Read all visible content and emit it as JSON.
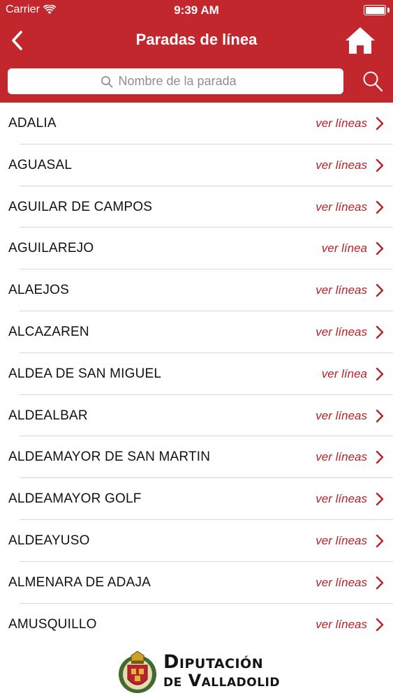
{
  "status_bar": {
    "carrier": "Carrier",
    "time": "9:39 AM"
  },
  "header": {
    "title": "Paradas de línea",
    "back_icon": "chevron-left-icon",
    "home_icon": "home-icon"
  },
  "search": {
    "placeholder": "Nombre de la parada",
    "value": ""
  },
  "colors": {
    "brand": "#c1272d",
    "link": "#b62229"
  },
  "stops": [
    {
      "name": "ADALIA",
      "action": "ver líneas"
    },
    {
      "name": "AGUASAL",
      "action": "ver líneas"
    },
    {
      "name": "AGUILAR DE CAMPOS",
      "action": "ver líneas"
    },
    {
      "name": "AGUILAREJO",
      "action": "ver línea"
    },
    {
      "name": "ALAEJOS",
      "action": "ver líneas"
    },
    {
      "name": "ALCAZAREN",
      "action": "ver líneas"
    },
    {
      "name": "ALDEA DE SAN MIGUEL",
      "action": "ver línea"
    },
    {
      "name": "ALDEALBAR",
      "action": "ver líneas"
    },
    {
      "name": "ALDEAMAYOR DE SAN MARTIN",
      "action": "ver líneas"
    },
    {
      "name": "ALDEAMAYOR GOLF",
      "action": "ver líneas"
    },
    {
      "name": "ALDEAYUSO",
      "action": "ver líneas"
    },
    {
      "name": "ALMENARA DE ADAJA",
      "action": "ver líneas"
    },
    {
      "name": "AMUSQUILLO",
      "action": "ver líneas"
    }
  ],
  "footer": {
    "line1": "Diputación",
    "line2": "de Valladolid"
  }
}
